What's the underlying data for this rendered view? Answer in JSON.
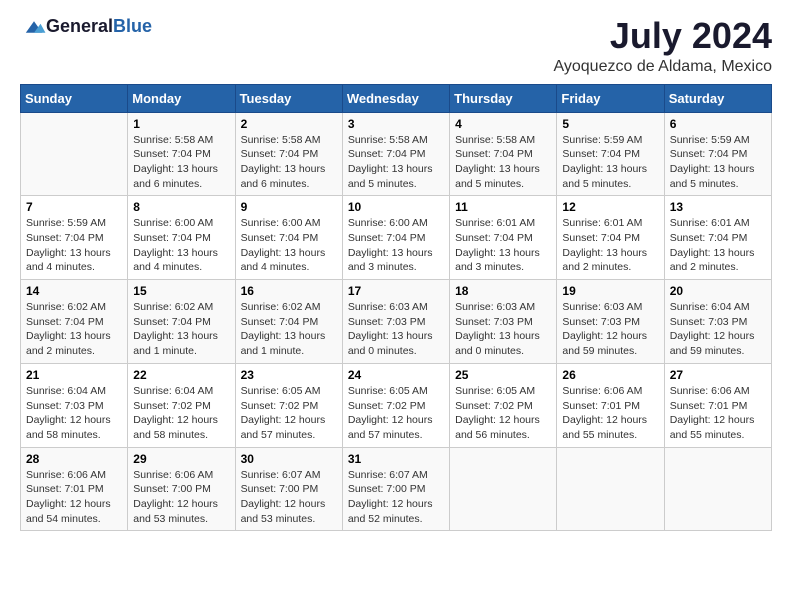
{
  "header": {
    "logo_general": "General",
    "logo_blue": "Blue",
    "month": "July 2024",
    "location": "Ayoquezco de Aldama, Mexico"
  },
  "weekdays": [
    "Sunday",
    "Monday",
    "Tuesday",
    "Wednesday",
    "Thursday",
    "Friday",
    "Saturday"
  ],
  "weeks": [
    [
      {
        "day": "",
        "info": ""
      },
      {
        "day": "1",
        "info": "Sunrise: 5:58 AM\nSunset: 7:04 PM\nDaylight: 13 hours\nand 6 minutes."
      },
      {
        "day": "2",
        "info": "Sunrise: 5:58 AM\nSunset: 7:04 PM\nDaylight: 13 hours\nand 6 minutes."
      },
      {
        "day": "3",
        "info": "Sunrise: 5:58 AM\nSunset: 7:04 PM\nDaylight: 13 hours\nand 5 minutes."
      },
      {
        "day": "4",
        "info": "Sunrise: 5:58 AM\nSunset: 7:04 PM\nDaylight: 13 hours\nand 5 minutes."
      },
      {
        "day": "5",
        "info": "Sunrise: 5:59 AM\nSunset: 7:04 PM\nDaylight: 13 hours\nand 5 minutes."
      },
      {
        "day": "6",
        "info": "Sunrise: 5:59 AM\nSunset: 7:04 PM\nDaylight: 13 hours\nand 5 minutes."
      }
    ],
    [
      {
        "day": "7",
        "info": "Sunrise: 5:59 AM\nSunset: 7:04 PM\nDaylight: 13 hours\nand 4 minutes."
      },
      {
        "day": "8",
        "info": "Sunrise: 6:00 AM\nSunset: 7:04 PM\nDaylight: 13 hours\nand 4 minutes."
      },
      {
        "day": "9",
        "info": "Sunrise: 6:00 AM\nSunset: 7:04 PM\nDaylight: 13 hours\nand 4 minutes."
      },
      {
        "day": "10",
        "info": "Sunrise: 6:00 AM\nSunset: 7:04 PM\nDaylight: 13 hours\nand 3 minutes."
      },
      {
        "day": "11",
        "info": "Sunrise: 6:01 AM\nSunset: 7:04 PM\nDaylight: 13 hours\nand 3 minutes."
      },
      {
        "day": "12",
        "info": "Sunrise: 6:01 AM\nSunset: 7:04 PM\nDaylight: 13 hours\nand 2 minutes."
      },
      {
        "day": "13",
        "info": "Sunrise: 6:01 AM\nSunset: 7:04 PM\nDaylight: 13 hours\nand 2 minutes."
      }
    ],
    [
      {
        "day": "14",
        "info": "Sunrise: 6:02 AM\nSunset: 7:04 PM\nDaylight: 13 hours\nand 2 minutes."
      },
      {
        "day": "15",
        "info": "Sunrise: 6:02 AM\nSunset: 7:04 PM\nDaylight: 13 hours\nand 1 minute."
      },
      {
        "day": "16",
        "info": "Sunrise: 6:02 AM\nSunset: 7:04 PM\nDaylight: 13 hours\nand 1 minute."
      },
      {
        "day": "17",
        "info": "Sunrise: 6:03 AM\nSunset: 7:03 PM\nDaylight: 13 hours\nand 0 minutes."
      },
      {
        "day": "18",
        "info": "Sunrise: 6:03 AM\nSunset: 7:03 PM\nDaylight: 13 hours\nand 0 minutes."
      },
      {
        "day": "19",
        "info": "Sunrise: 6:03 AM\nSunset: 7:03 PM\nDaylight: 12 hours\nand 59 minutes."
      },
      {
        "day": "20",
        "info": "Sunrise: 6:04 AM\nSunset: 7:03 PM\nDaylight: 12 hours\nand 59 minutes."
      }
    ],
    [
      {
        "day": "21",
        "info": "Sunrise: 6:04 AM\nSunset: 7:03 PM\nDaylight: 12 hours\nand 58 minutes."
      },
      {
        "day": "22",
        "info": "Sunrise: 6:04 AM\nSunset: 7:02 PM\nDaylight: 12 hours\nand 58 minutes."
      },
      {
        "day": "23",
        "info": "Sunrise: 6:05 AM\nSunset: 7:02 PM\nDaylight: 12 hours\nand 57 minutes."
      },
      {
        "day": "24",
        "info": "Sunrise: 6:05 AM\nSunset: 7:02 PM\nDaylight: 12 hours\nand 57 minutes."
      },
      {
        "day": "25",
        "info": "Sunrise: 6:05 AM\nSunset: 7:02 PM\nDaylight: 12 hours\nand 56 minutes."
      },
      {
        "day": "26",
        "info": "Sunrise: 6:06 AM\nSunset: 7:01 PM\nDaylight: 12 hours\nand 55 minutes."
      },
      {
        "day": "27",
        "info": "Sunrise: 6:06 AM\nSunset: 7:01 PM\nDaylight: 12 hours\nand 55 minutes."
      }
    ],
    [
      {
        "day": "28",
        "info": "Sunrise: 6:06 AM\nSunset: 7:01 PM\nDaylight: 12 hours\nand 54 minutes."
      },
      {
        "day": "29",
        "info": "Sunrise: 6:06 AM\nSunset: 7:00 PM\nDaylight: 12 hours\nand 53 minutes."
      },
      {
        "day": "30",
        "info": "Sunrise: 6:07 AM\nSunset: 7:00 PM\nDaylight: 12 hours\nand 53 minutes."
      },
      {
        "day": "31",
        "info": "Sunrise: 6:07 AM\nSunset: 7:00 PM\nDaylight: 12 hours\nand 52 minutes."
      },
      {
        "day": "",
        "info": ""
      },
      {
        "day": "",
        "info": ""
      },
      {
        "day": "",
        "info": ""
      }
    ]
  ]
}
